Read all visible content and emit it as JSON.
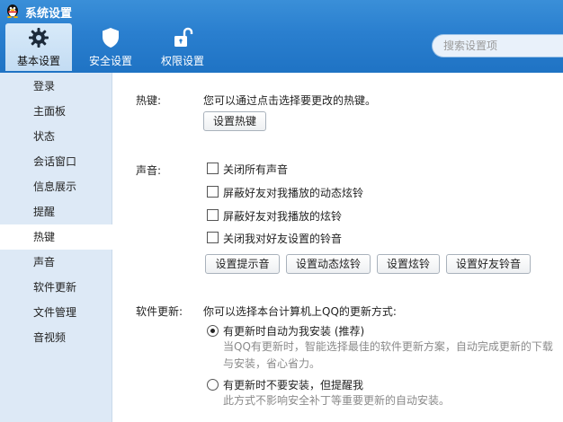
{
  "window": {
    "title": "系统设置"
  },
  "tabs": [
    {
      "label": "基本设置",
      "icon": "gear-icon",
      "active": true
    },
    {
      "label": "安全设置",
      "icon": "shield-icon",
      "active": false
    },
    {
      "label": "权限设置",
      "icon": "unlock-icon",
      "active": false
    }
  ],
  "search": {
    "placeholder": "搜索设置项"
  },
  "sidebar": {
    "items": [
      {
        "label": "登录"
      },
      {
        "label": "主面板"
      },
      {
        "label": "状态"
      },
      {
        "label": "会话窗口"
      },
      {
        "label": "信息展示"
      },
      {
        "label": "提醒"
      },
      {
        "label": "热键",
        "active": true
      },
      {
        "label": "声音"
      },
      {
        "label": "软件更新"
      },
      {
        "label": "文件管理"
      },
      {
        "label": "音视频"
      }
    ]
  },
  "hotkey": {
    "section_label": "热键:",
    "description": "您可以通过点击选择要更改的热键。",
    "set_button": "设置热键"
  },
  "sound": {
    "section_label": "声音:",
    "options": [
      {
        "label": "关闭所有声音",
        "checked": false
      },
      {
        "label": "屏蔽好友对我播放的动态炫铃",
        "checked": false
      },
      {
        "label": "屏蔽好友对我播放的炫铃",
        "checked": false
      },
      {
        "label": "关闭我对好友设置的铃音",
        "checked": false
      }
    ],
    "buttons": [
      "设置提示音",
      "设置动态炫铃",
      "设置炫铃",
      "设置好友铃音"
    ]
  },
  "update": {
    "section_label": "软件更新:",
    "description": "你可以选择本台计算机上QQ的更新方式:",
    "options": [
      {
        "label": "有更新时自动为我安装 (推荐)",
        "selected": true,
        "desc_line1": "当QQ有更新时，智能选择最佳的软件更新方案，自动完成更新的下载",
        "desc_line2": "与安装，省心省力。"
      },
      {
        "label": "有更新时不要安装，但提醒我",
        "selected": false,
        "desc_line1": "此方式不影响安全补丁等重要更新的自动安装。"
      }
    ]
  },
  "colors": {
    "header": "#2a7fcf",
    "sidebar": "#dde9f6",
    "active_tab": "#c3dcf3"
  }
}
